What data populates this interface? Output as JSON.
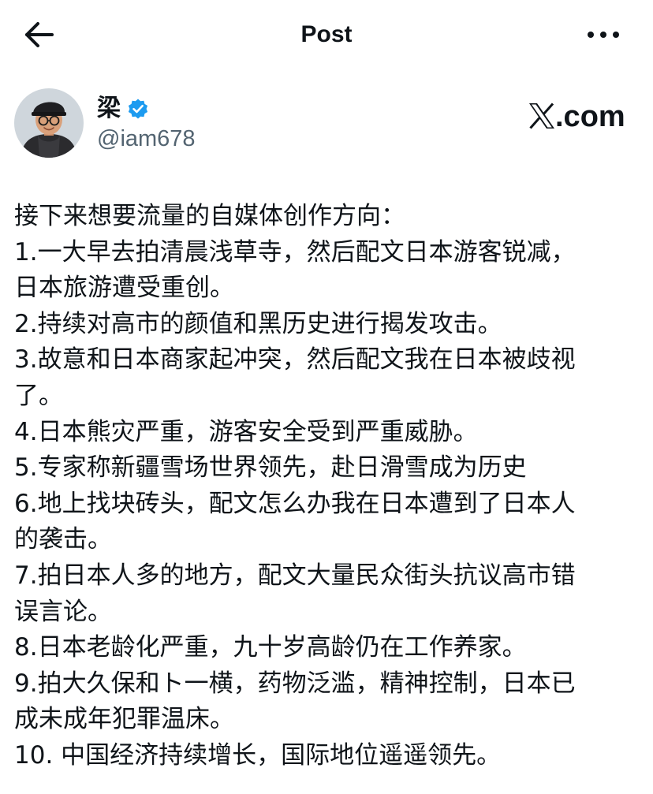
{
  "header": {
    "title": "Post",
    "back_icon": "arrow-left-icon",
    "more_icon": "more-horizontal-icon"
  },
  "author": {
    "display_name": "梁",
    "handle": "@iam678",
    "verified": true,
    "verified_color": "#1d9bf0",
    "avatar_icon": "avatar-photo"
  },
  "watermark": {
    "text": ".com",
    "icon": "x-logo-icon"
  },
  "post": {
    "lines": [
      "接下来想要流量的自媒体创作方向：",
      "1.一大早去拍清晨浅草寺，然后配文日本游客锐减，",
      "日本旅游遭受重创。",
      "2.持续对高市的颜值和黑历史进行揭发攻击。",
      "3.故意和日本商家起冲突，然后配文我在日本被歧视",
      "了。",
      "4.日本熊灾严重，游客安全受到严重威胁。",
      "5.专家称新疆雪场世界领先，赴日滑雪成为历史",
      "6.地上找块砖头，配文怎么办我在日本遭到了日本人",
      "的袭击。",
      "7.拍日本人多的地方，配文大量民众街头抗议高市错",
      "误言论。",
      "8.日本老龄化严重，九十岁高龄仍在工作养家。",
      "9.拍大久保和ト一横，药物泛滥，精神控制，日本已",
      "成未成年犯罪温床。",
      "10. 中国经济持续增长，国际地位遥遥领先。"
    ]
  },
  "colors": {
    "text": "#0f1419",
    "secondary_text": "#536471",
    "accent": "#1d9bf0",
    "background": "#ffffff"
  }
}
